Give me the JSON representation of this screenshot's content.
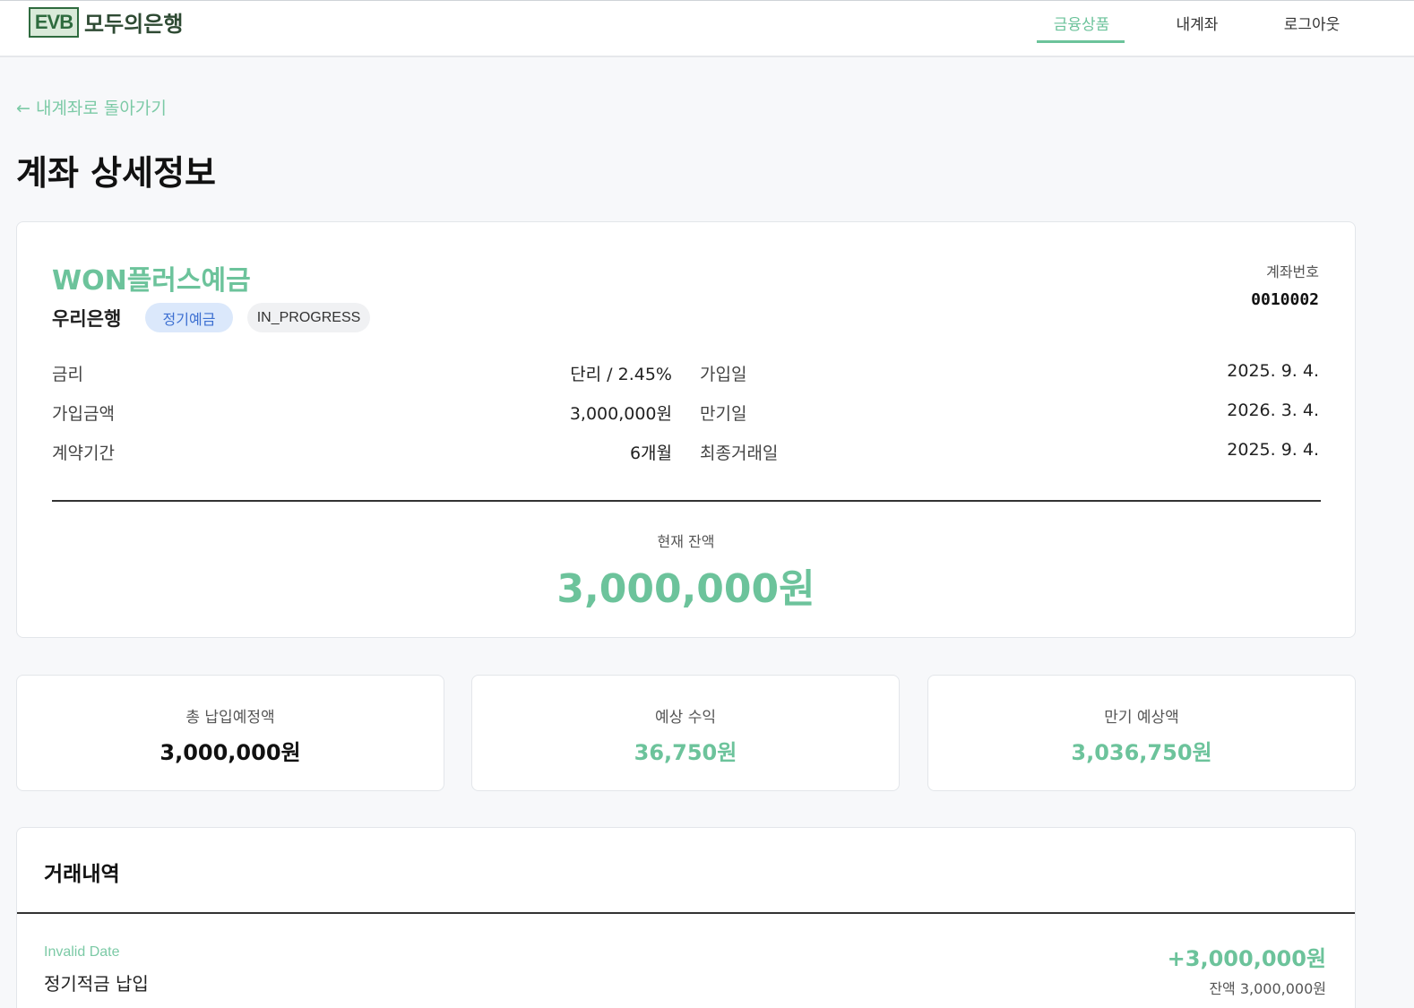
{
  "header": {
    "logo_mark": "EVB",
    "logo_text": "모두의은행",
    "nav": [
      {
        "label": "금융상품",
        "active": true
      },
      {
        "label": "내계좌",
        "active": false
      },
      {
        "label": "로그아웃",
        "active": false
      }
    ]
  },
  "back_link": "← 내계좌로 돌아가기",
  "page_title": "계좌 상세정보",
  "account": {
    "product_name": "WON플러스예금",
    "bank_name": "우리은행",
    "type_badge": "정기예금",
    "status_badge": "IN_PROGRESS",
    "number_label": "계좌번호",
    "number": "0010002",
    "details_left": [
      {
        "label": "금리",
        "value": "단리 / 2.45%"
      },
      {
        "label": "가입금액",
        "value": "3,000,000원"
      },
      {
        "label": "계약기간",
        "value": "6개월"
      }
    ],
    "details_right": [
      {
        "label": "가입일",
        "value": "2025. 9. 4."
      },
      {
        "label": "만기일",
        "value": "2026. 3. 4."
      },
      {
        "label": "최종거래일",
        "value": "2025. 9. 4."
      }
    ],
    "balance_label": "현재 잔액",
    "balance_value": "3,000,000원"
  },
  "stats": [
    {
      "label": "총 납입예정액",
      "value": "3,000,000원",
      "color": "#111111"
    },
    {
      "label": "예상 수익",
      "value": "36,750원",
      "color": "#6cc39b"
    },
    {
      "label": "만기 예상액",
      "value": "3,036,750원",
      "color": "#6cc39b"
    }
  ],
  "transactions": {
    "title": "거래내역",
    "items": [
      {
        "date": "Invalid Date",
        "description": "정기적금 납입",
        "amount": "+3,000,000원",
        "balance": "잔액 3,000,000원"
      }
    ]
  },
  "colors": {
    "accent": "#6cc39b",
    "badge_blue": "#3c6fd1"
  }
}
